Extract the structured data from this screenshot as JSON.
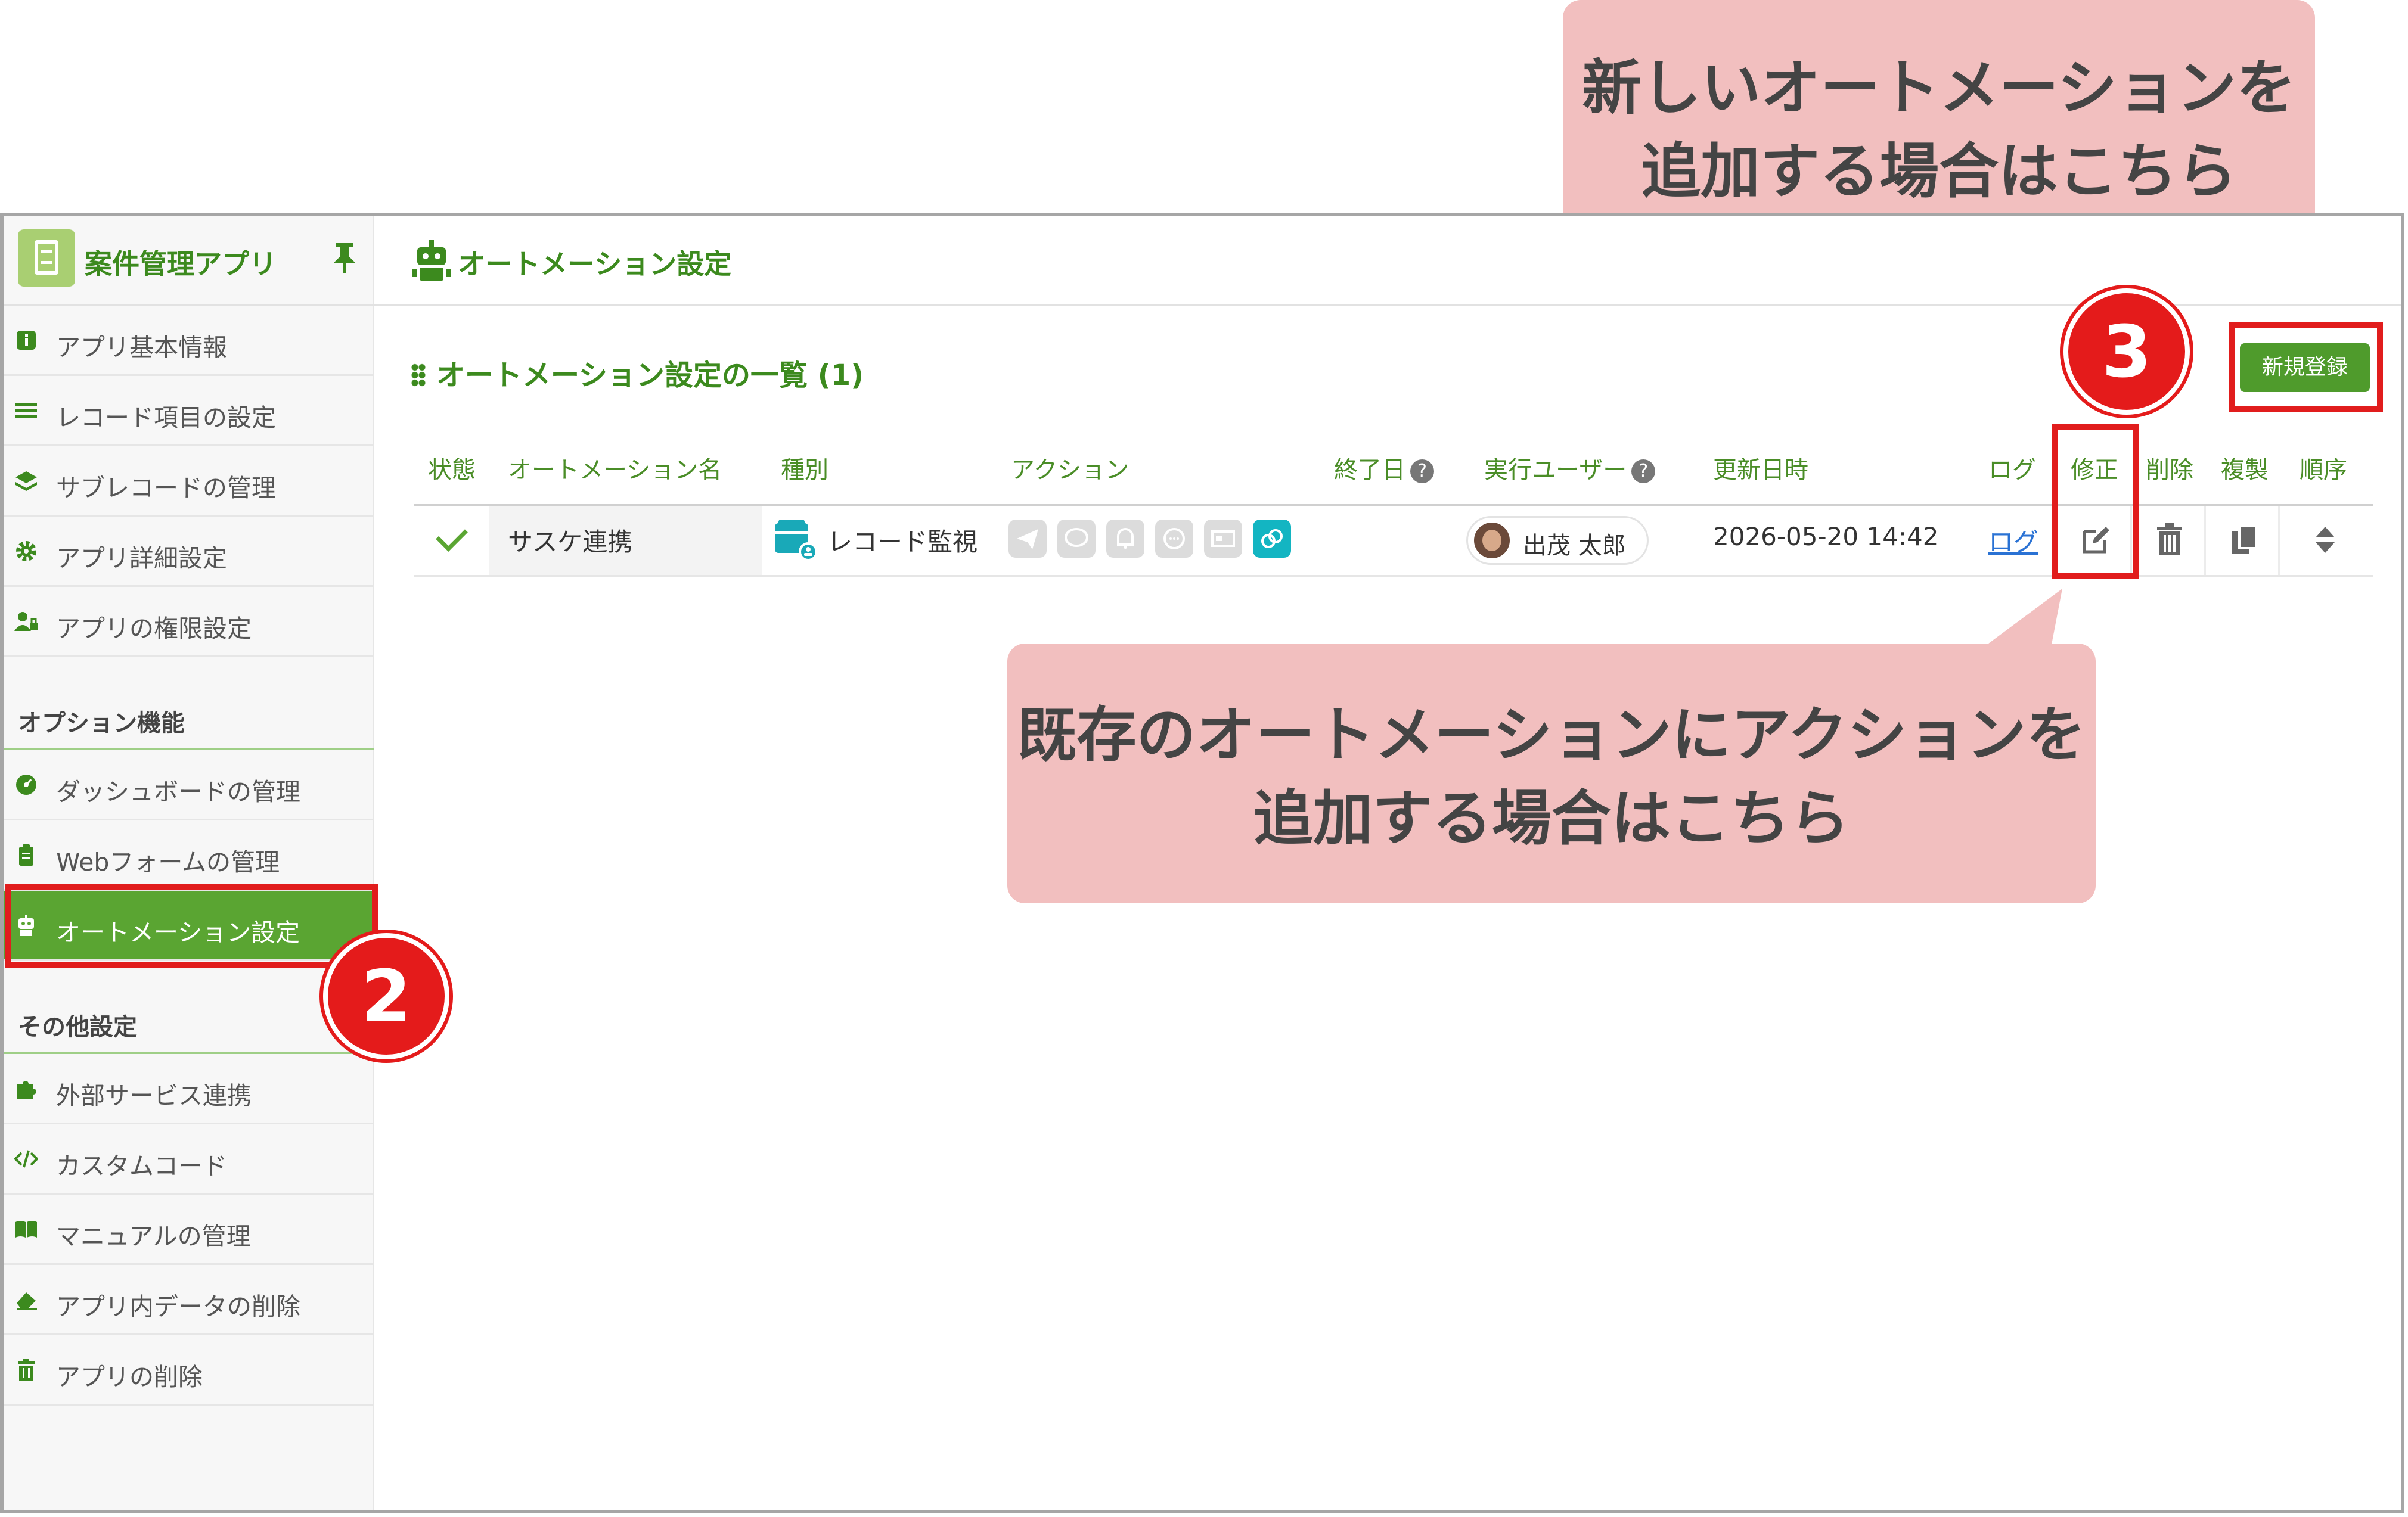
{
  "callouts": {
    "top": [
      "新しいオートメーションを",
      "追加する場合はこちら"
    ],
    "middle": [
      "既存のオートメーションにアクションを",
      "追加する場合はこちら"
    ]
  },
  "badges": {
    "step2": "2",
    "step3": "3"
  },
  "sidebar": {
    "app_title": "案件管理アプリ",
    "items_top": [
      {
        "label": "アプリ基本情報",
        "icon": "info-icon"
      },
      {
        "label": "レコード項目の設定",
        "icon": "list-icon"
      },
      {
        "label": "サブレコードの管理",
        "icon": "layers-icon"
      },
      {
        "label": "アプリ詳細設定",
        "icon": "gear-icon"
      },
      {
        "label": "アプリの権限設定",
        "icon": "user-lock-icon"
      }
    ],
    "section_options": "オプション機能",
    "items_options": [
      {
        "label": "ダッシュボードの管理",
        "icon": "dashboard-icon"
      },
      {
        "label": "Webフォームの管理",
        "icon": "clipboard-icon"
      },
      {
        "label": "オートメーション設定",
        "icon": "robot-icon"
      }
    ],
    "section_other": "その他設定",
    "items_other": [
      {
        "label": "外部サービス連携",
        "icon": "puzzle-icon"
      },
      {
        "label": "カスタムコード",
        "icon": "code-icon"
      },
      {
        "label": "マニュアルの管理",
        "icon": "book-icon"
      },
      {
        "label": "アプリ内データの削除",
        "icon": "eraser-icon"
      },
      {
        "label": "アプリの削除",
        "icon": "trash-icon"
      }
    ]
  },
  "header": {
    "title": "オートメーション設定"
  },
  "list": {
    "title": "オートメーション設定の一覧 (1)",
    "new_button": "新規登録",
    "columns": [
      "状態",
      "オートメーション名",
      "種別",
      "アクション",
      "終了日",
      "実行ユーザー",
      "更新日時",
      "ログ",
      "修正",
      "削除",
      "複製",
      "順序"
    ],
    "help_mark": "?",
    "rows": [
      {
        "status": "check-icon",
        "name": "サスケ連携",
        "type": "レコード監視",
        "actions": [
          "send-icon",
          "chat-icon",
          "bell-icon",
          "message-icon",
          "card-icon",
          "link-icon"
        ],
        "end_date": "",
        "user": "出茂 太郎",
        "updated": "2026-05-20 14:42",
        "log": "ログ"
      }
    ]
  },
  "colors": {
    "brand_green": "#3c8a1e",
    "active_green": "#5aa532",
    "highlight_red": "#e11d1d",
    "callout_pink": "#f2bfbf"
  }
}
